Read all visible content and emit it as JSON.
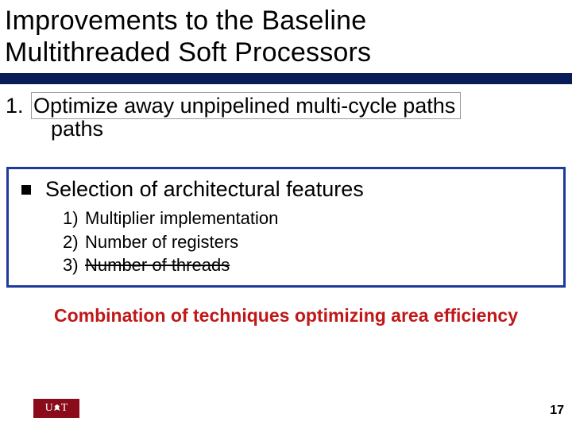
{
  "title": {
    "line1": "Improvements to the Baseline",
    "line2": "Multithreaded Soft Processors"
  },
  "item1": {
    "number": "1.",
    "boxed_text": "Optimize away unpipelined multi-cycle paths",
    "trailing": "paths"
  },
  "arch": {
    "heading": "Selection of architectural features",
    "items": [
      {
        "num": "1)",
        "label": "Multiplier implementation",
        "struck": false
      },
      {
        "num": "2)",
        "label": "Number of registers",
        "struck": false
      },
      {
        "num": "3)",
        "label": "Number of threads",
        "struck": true
      }
    ]
  },
  "combination": "Combination of techniques optimizing area efficiency",
  "logo": {
    "left": "U",
    "right": "T"
  },
  "page_number": "17"
}
